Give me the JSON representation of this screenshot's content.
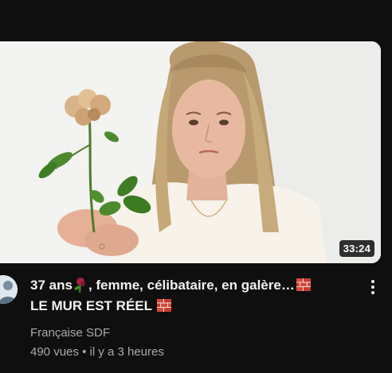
{
  "video": {
    "duration": "33:24",
    "title_line1_a": "37 ans",
    "title_line1_b": ", femme, célibataire, en galère…",
    "title_line2": "LE MUR EST RÉEL",
    "channel": "Française SDF",
    "views": "490 vues",
    "separator": "•",
    "age": "il y a 3 heures"
  },
  "icons": {
    "rose": "wilted-rose-emoji",
    "brick": "brick-emoji",
    "more": "vertical-ellipsis-icon"
  },
  "colors": {
    "background": "#0f0f0f",
    "title": "#f1f1f1",
    "secondary_text": "#aaaaaa",
    "duration_badge": "#000000cc"
  }
}
